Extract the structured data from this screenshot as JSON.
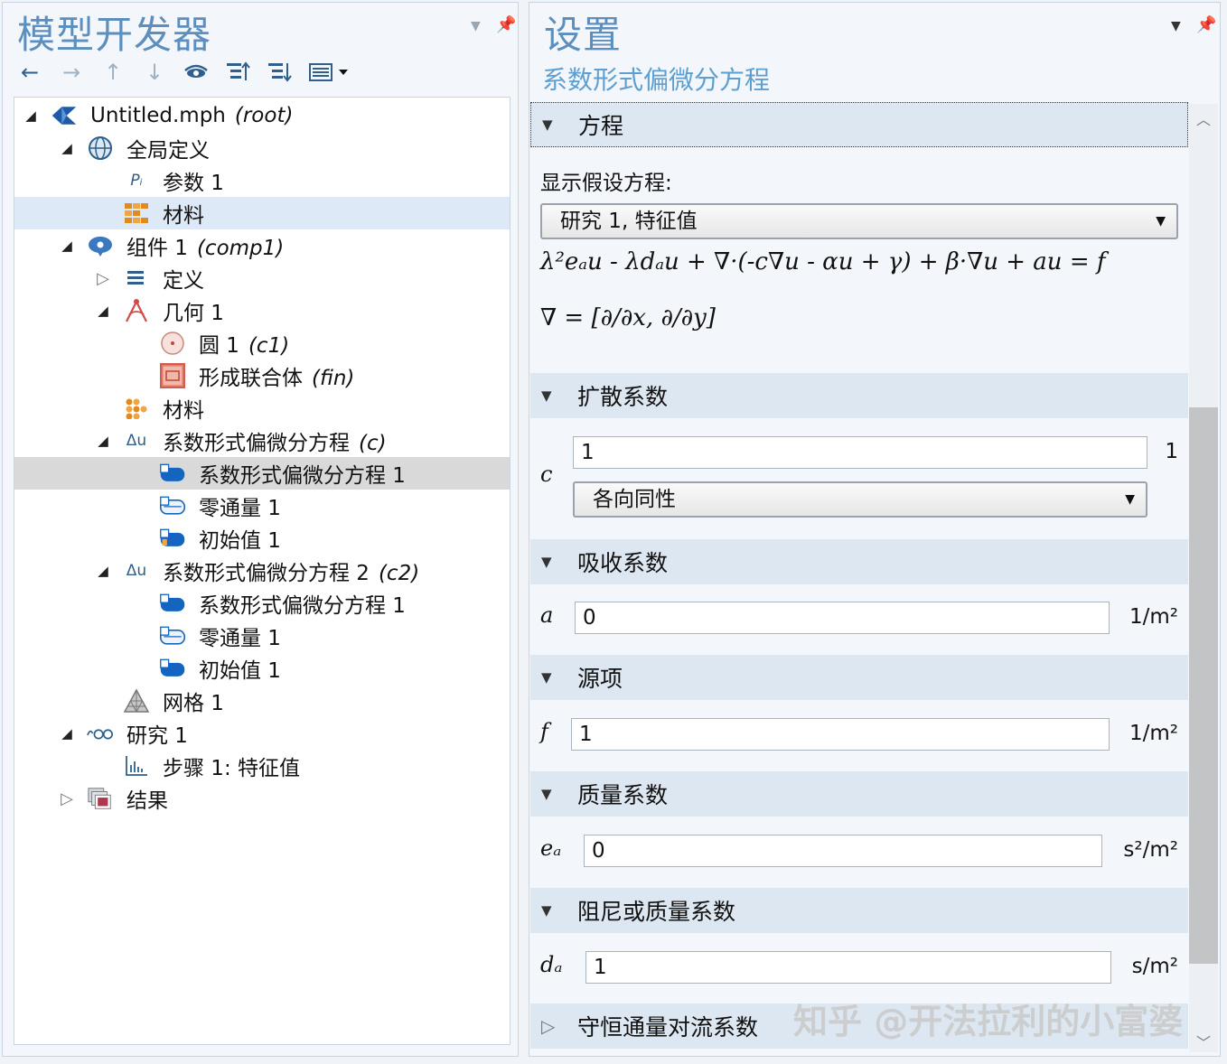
{
  "left_panel": {
    "title": "模型开发器",
    "tree": [
      {
        "label": "Untitled.mph",
        "tag": "(root)",
        "icon": "model-icon"
      },
      {
        "label": "全局定义",
        "tag": "",
        "icon": "globe-icon"
      },
      {
        "label": "参数 1",
        "tag": "",
        "icon": "parameters-icon"
      },
      {
        "label": "材料",
        "tag": "",
        "icon": "materials-icon"
      },
      {
        "label": "组件 1",
        "tag": "(comp1)",
        "icon": "component-icon"
      },
      {
        "label": "定义",
        "tag": "",
        "icon": "definitions-icon"
      },
      {
        "label": "几何 1",
        "tag": "",
        "icon": "geometry-icon"
      },
      {
        "label": "圆 1",
        "tag": "(c1)",
        "icon": "circle-icon"
      },
      {
        "label": "形成联合体",
        "tag": "(fin)",
        "icon": "form-union-icon"
      },
      {
        "label": "材料",
        "tag": "",
        "icon": "materials-icon"
      },
      {
        "label": "系数形式偏微分方程",
        "tag": "(c)",
        "icon": "pde-icon"
      },
      {
        "label": "系数形式偏微分方程 1",
        "tag": "",
        "icon": "domain-feature-icon"
      },
      {
        "label": "零通量 1",
        "tag": "",
        "icon": "boundary-feature-icon"
      },
      {
        "label": "初始值 1",
        "tag": "",
        "icon": "initial-values-icon"
      },
      {
        "label": "系数形式偏微分方程 2",
        "tag": "(c2)",
        "icon": "pde-icon"
      },
      {
        "label": "系数形式偏微分方程 1",
        "tag": "",
        "icon": "domain-feature-icon"
      },
      {
        "label": "零通量 1",
        "tag": "",
        "icon": "boundary-feature-icon"
      },
      {
        "label": "初始值 1",
        "tag": "",
        "icon": "initial-values-icon"
      },
      {
        "label": "网格 1",
        "tag": "",
        "icon": "mesh-icon"
      },
      {
        "label": "研究 1",
        "tag": "",
        "icon": "study-icon"
      },
      {
        "label": "步骤 1: 特征值",
        "tag": "",
        "icon": "eigenvalue-step-icon"
      },
      {
        "label": "结果",
        "tag": "",
        "icon": "results-icon"
      }
    ]
  },
  "right_panel": {
    "title": "设置",
    "subtitle": "系数形式偏微分方程",
    "equation_section": {
      "header": "方程",
      "show_label": "显示假设方程:",
      "study_select": "研究 1, 特征值",
      "equation_line1": "λ²eₐu - λdₐu + ∇·(-c∇u - αu + γ) + β·∇u + au = f",
      "equation_line2": "∇ = [∂/∂x, ∂/∂y]"
    },
    "diffusion": {
      "header": "扩散系数",
      "var": "c",
      "value": "1",
      "unit": "1",
      "select": "各向同性"
    },
    "absorption": {
      "header": "吸收系数",
      "var": "a",
      "value": "0",
      "unit": "1/m²"
    },
    "source": {
      "header": "源项",
      "var": "f",
      "value": "1",
      "unit": "1/m²"
    },
    "mass": {
      "header": "质量系数",
      "var": "eₐ",
      "value": "0",
      "unit": "s²/m²"
    },
    "damping": {
      "header": "阻尼或质量系数",
      "var": "dₐ",
      "value": "1",
      "unit": "s/m²"
    },
    "convection": {
      "header": "守恒通量对流系数"
    }
  },
  "watermark": "知乎 @开法拉利的小富婆"
}
